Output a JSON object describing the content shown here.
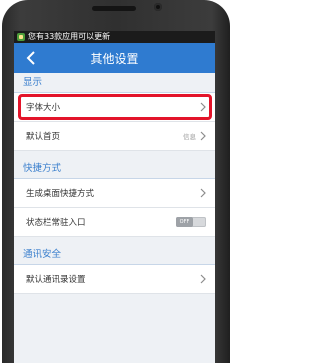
{
  "status_bar": {
    "notification": "您有33款应用可以更新",
    "app_icon": "app-update-icon"
  },
  "title_bar": {
    "title": "其他设置",
    "back_icon": "chevron-left-icon"
  },
  "sections": [
    {
      "header": "显示",
      "rows": [
        {
          "label": "字体大小",
          "hint": "",
          "control": "chevron",
          "highlighted": true
        },
        {
          "label": "默认首页",
          "hint": "信息",
          "control": "chevron",
          "highlighted": false
        }
      ]
    },
    {
      "header": "快捷方式",
      "rows": [
        {
          "label": "生成桌面快捷方式",
          "hint": "",
          "control": "chevron",
          "highlighted": false
        },
        {
          "label": "状态栏常驻入口",
          "hint": "",
          "control": "toggle",
          "toggle_text": "OFF",
          "toggle_on": false
        }
      ]
    },
    {
      "header": "通讯安全",
      "rows": [
        {
          "label": "默认通讯录设置",
          "hint": "",
          "control": "chevron",
          "highlighted": false
        }
      ]
    }
  ],
  "colors": {
    "accent": "#2f7bd0",
    "section_header_text": "#3a7fcd",
    "highlight_box": "#e3142a"
  }
}
